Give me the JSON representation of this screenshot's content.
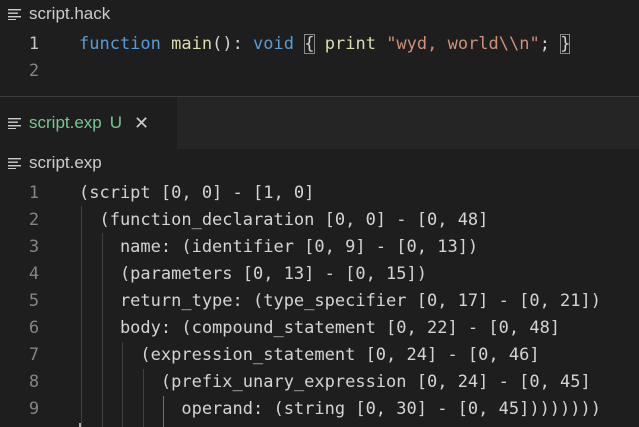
{
  "top_editor": {
    "breadcrumb": "script.hack",
    "lines": [
      {
        "number": "1",
        "tokens": [
          {
            "text": "function",
            "cls": "kw"
          },
          {
            "text": " ",
            "cls": "pl"
          },
          {
            "text": "main",
            "cls": "fn"
          },
          {
            "text": "(): ",
            "cls": "pl"
          },
          {
            "text": "void",
            "cls": "kw"
          },
          {
            "text": " ",
            "cls": "pl"
          },
          {
            "text": "{",
            "cls": "pl bracket-match"
          },
          {
            "text": " ",
            "cls": "pl"
          },
          {
            "text": "print",
            "cls": "fn"
          },
          {
            "text": " ",
            "cls": "pl"
          },
          {
            "text": "\"wyd, world\\\\n\"",
            "cls": "str"
          },
          {
            "text": "; ",
            "cls": "pl"
          },
          {
            "text": "}",
            "cls": "pl bracket-match"
          }
        ]
      },
      {
        "number": "2",
        "tokens": []
      }
    ]
  },
  "tab": {
    "label": "script.exp",
    "status": "U",
    "close": "✕"
  },
  "bottom_editor": {
    "breadcrumb": "script.exp",
    "lines": [
      {
        "number": "1",
        "text": "(script [0, 0] - [1, 0]"
      },
      {
        "number": "2",
        "text": "  (function_declaration [0, 0] - [0, 48]"
      },
      {
        "number": "3",
        "text": "    name: (identifier [0, 9] - [0, 13])"
      },
      {
        "number": "4",
        "text": "    (parameters [0, 13] - [0, 15])"
      },
      {
        "number": "5",
        "text": "    return_type: (type_specifier [0, 17] - [0, 21])"
      },
      {
        "number": "6",
        "text": "    body: (compound_statement [0, 22] - [0, 48]"
      },
      {
        "number": "7",
        "text": "      (expression_statement [0, 24] - [0, 46]"
      },
      {
        "number": "8",
        "text": "        (prefix_unary_expression [0, 24] - [0, 45]"
      },
      {
        "number": "9",
        "text": "          operand: (string [0, 30] - [0, 45])))))))"
      }
    ]
  },
  "colors": {
    "background": "#1e1e1e",
    "keyword": "#569cd6",
    "function": "#dcdcaa",
    "string": "#ce9178",
    "untracked_file": "#73c991",
    "line_number": "#858585"
  },
  "icons": {
    "file_lines": "lines-icon",
    "close": "close-icon"
  }
}
